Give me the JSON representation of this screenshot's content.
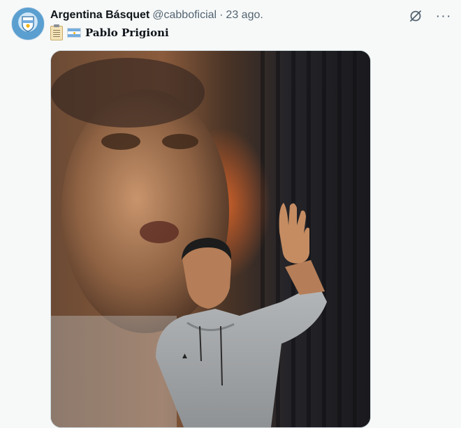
{
  "tweet": {
    "author_name": "Argentina Básquet",
    "handle": "@cabboficial",
    "separator": "·",
    "date": "23 ago.",
    "text": "Pablo Prigioni",
    "emoji": [
      "clipboard-icon",
      "argentina-flag-icon"
    ]
  },
  "actions": {
    "grok_icon": "grok-slash-circle-icon",
    "more_label": "···"
  },
  "media": {
    "description_icon": "photo",
    "colors": {
      "background": "#1a1a1e",
      "hoodie": "#a8abad"
    }
  },
  "theme": {
    "bg": "#f7f9f9",
    "text": "#0f1419",
    "muted": "#536471"
  }
}
